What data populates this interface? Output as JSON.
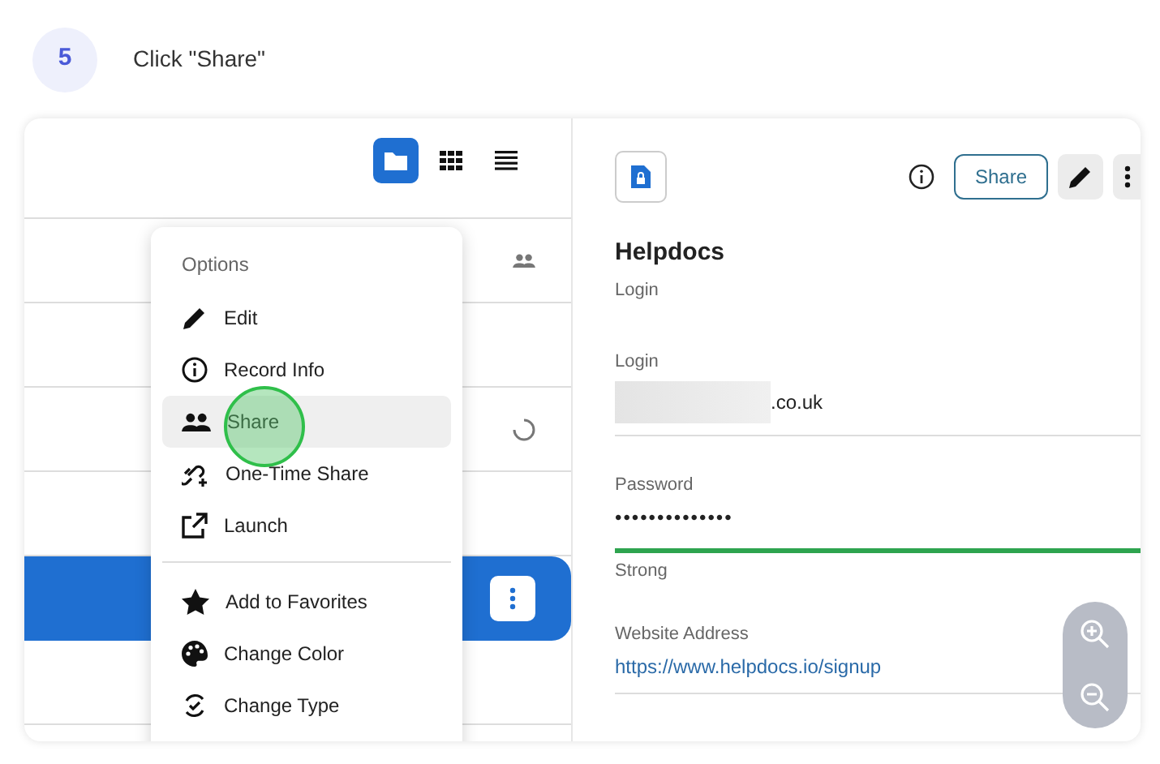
{
  "step": {
    "number": "5",
    "instruction": "Click \"Share\""
  },
  "view_toggles": [
    {
      "kind": "folder",
      "selected": true
    },
    {
      "kind": "grid",
      "selected": false
    },
    {
      "kind": "list",
      "selected": false
    }
  ],
  "rows": [
    {
      "kind": "shared",
      "selected": false
    },
    {
      "kind": "plain",
      "selected": false
    },
    {
      "kind": "syncing",
      "selected": false
    },
    {
      "kind": "plain",
      "selected": false
    },
    {
      "kind": "actions",
      "selected": true
    },
    {
      "kind": "plain",
      "selected": false
    }
  ],
  "menu": {
    "title": "Options",
    "sections": [
      [
        {
          "kind": "edit",
          "label": "Edit",
          "selected": false
        },
        {
          "kind": "info",
          "label": "Record Info",
          "selected": false
        },
        {
          "kind": "share",
          "label": "Share",
          "selected": true
        },
        {
          "kind": "onetime",
          "label": "One-Time Share",
          "selected": false
        },
        {
          "kind": "launch",
          "label": "Launch",
          "selected": false
        }
      ],
      [
        {
          "kind": "star",
          "label": "Add to Favorites",
          "selected": false
        },
        {
          "kind": "palette",
          "label": "Change Color",
          "selected": false
        },
        {
          "kind": "type",
          "label": "Change Type",
          "selected": false
        }
      ]
    ]
  },
  "detail": {
    "title": "Helpdocs",
    "subtitle": "Login",
    "share_button": "Share",
    "fields": [
      {
        "kind": "text",
        "label": "Login",
        "value": ".co.uk",
        "redacted": true
      },
      {
        "kind": "password",
        "label": "Password",
        "value": "••••••••••••••",
        "level": 1,
        "strength": "Strong"
      },
      {
        "kind": "link",
        "label": "Website Address",
        "value": "https://www.helpdocs.io/signup"
      }
    ]
  }
}
